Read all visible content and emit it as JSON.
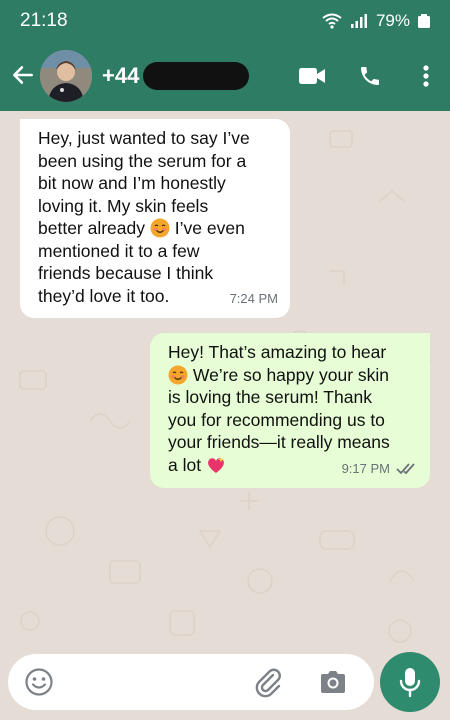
{
  "status_bar": {
    "time": "21:18",
    "battery": "79%"
  },
  "header": {
    "contact_name_visible": "+44",
    "icons": [
      "back-arrow-icon",
      "video-call-icon",
      "phone-icon",
      "more-vert-icon"
    ],
    "theme_color": "#2f7c64"
  },
  "messages": [
    {
      "direction": "incoming",
      "parts": [
        "Hey, just wanted to say I’ve\nbeen using the serum for a\nbit now and I’m honestly\nloving it. My skin feels\nbetter already",
        " I’ve even\nmentioned it to a few\nfriends because I think\nthey’d love it too."
      ],
      "emoji": "smiling-face-icon",
      "time": "7:24 PM"
    },
    {
      "direction": "outgoing",
      "parts": [
        "Hey! That’s amazing to hear\n",
        " We’re so happy your skin\nis loving the serum! Thank\nyou for recommending us to\nyour friends—it really means\na lot "
      ],
      "emojis": [
        "smiling-face-icon",
        "sparkling-heart-icon"
      ],
      "time": "9:17 PM",
      "status": "read"
    }
  ],
  "input_bar": {
    "icons": [
      "emoji-icon",
      "attach-icon",
      "camera-icon",
      "mic-icon"
    ]
  },
  "colors": {
    "incoming_bubble": "#ffffff",
    "outgoing_bubble": "#e6fdd5",
    "read_ticks": "#6b7278",
    "chat_bg": "#e5ddd5"
  }
}
